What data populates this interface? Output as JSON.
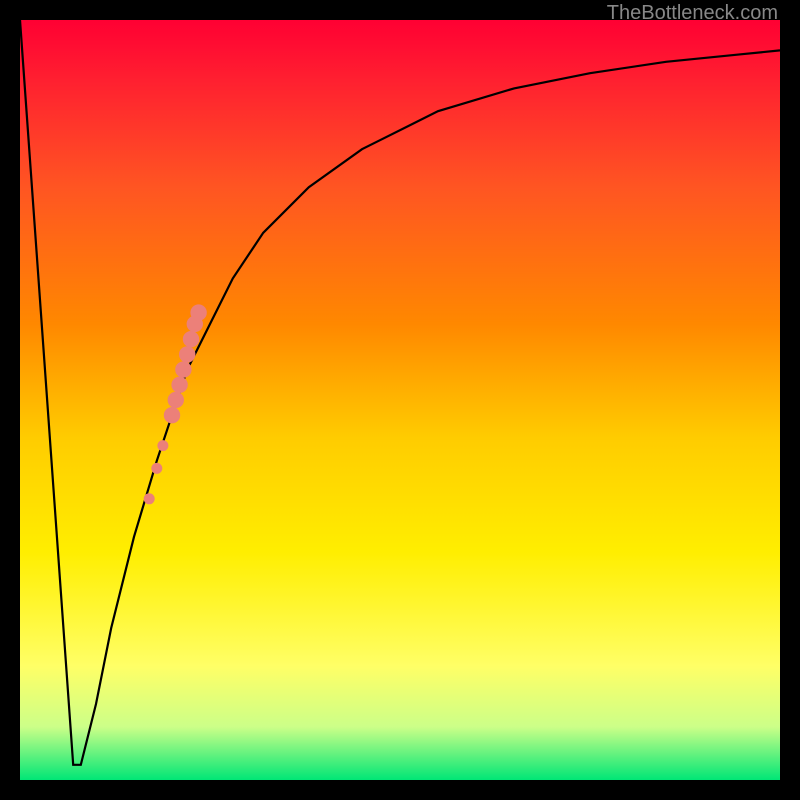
{
  "watermark": "TheBottleneck.com",
  "chart_data": {
    "type": "line",
    "title": "",
    "xlabel": "",
    "ylabel": "",
    "xlim": [
      0,
      100
    ],
    "ylim": [
      0,
      100
    ],
    "background_gradient": {
      "stops": [
        {
          "pos": 0,
          "color": "#ff0033"
        },
        {
          "pos": 8,
          "color": "#ff2030"
        },
        {
          "pos": 22,
          "color": "#ff5522"
        },
        {
          "pos": 40,
          "color": "#ff8800"
        },
        {
          "pos": 55,
          "color": "#ffcc00"
        },
        {
          "pos": 70,
          "color": "#ffee00"
        },
        {
          "pos": 85,
          "color": "#ffff66"
        },
        {
          "pos": 93,
          "color": "#ccff88"
        },
        {
          "pos": 100,
          "color": "#00e676"
        }
      ]
    },
    "series": [
      {
        "name": "bottleneck-curve",
        "color": "#000000",
        "x": [
          0,
          7,
          8,
          10,
          12,
          15,
          18,
          20,
          22,
          25,
          28,
          32,
          38,
          45,
          55,
          65,
          75,
          85,
          95,
          100
        ],
        "y": [
          100,
          2,
          2,
          10,
          20,
          32,
          42,
          48,
          54,
          60,
          66,
          72,
          78,
          83,
          88,
          91,
          93,
          94.5,
          95.5,
          96
        ]
      }
    ],
    "markers": [
      {
        "name": "highlight-salmon-segment",
        "color": "#ec8079",
        "shape": "circle",
        "points": [
          {
            "x": 17.0,
            "y": 37.0,
            "r": 0.8
          },
          {
            "x": 18.0,
            "y": 41.0,
            "r": 0.8
          },
          {
            "x": 18.8,
            "y": 44.0,
            "r": 0.8
          },
          {
            "x": 20.0,
            "y": 48.0,
            "r": 1.2
          },
          {
            "x": 20.5,
            "y": 50.0,
            "r": 1.2
          },
          {
            "x": 21.0,
            "y": 52.0,
            "r": 1.2
          },
          {
            "x": 21.5,
            "y": 54.0,
            "r": 1.2
          },
          {
            "x": 22.0,
            "y": 56.0,
            "r": 1.2
          },
          {
            "x": 22.5,
            "y": 58.0,
            "r": 1.2
          },
          {
            "x": 23.0,
            "y": 60.0,
            "r": 1.2
          },
          {
            "x": 23.5,
            "y": 61.5,
            "r": 1.2
          }
        ]
      }
    ]
  }
}
